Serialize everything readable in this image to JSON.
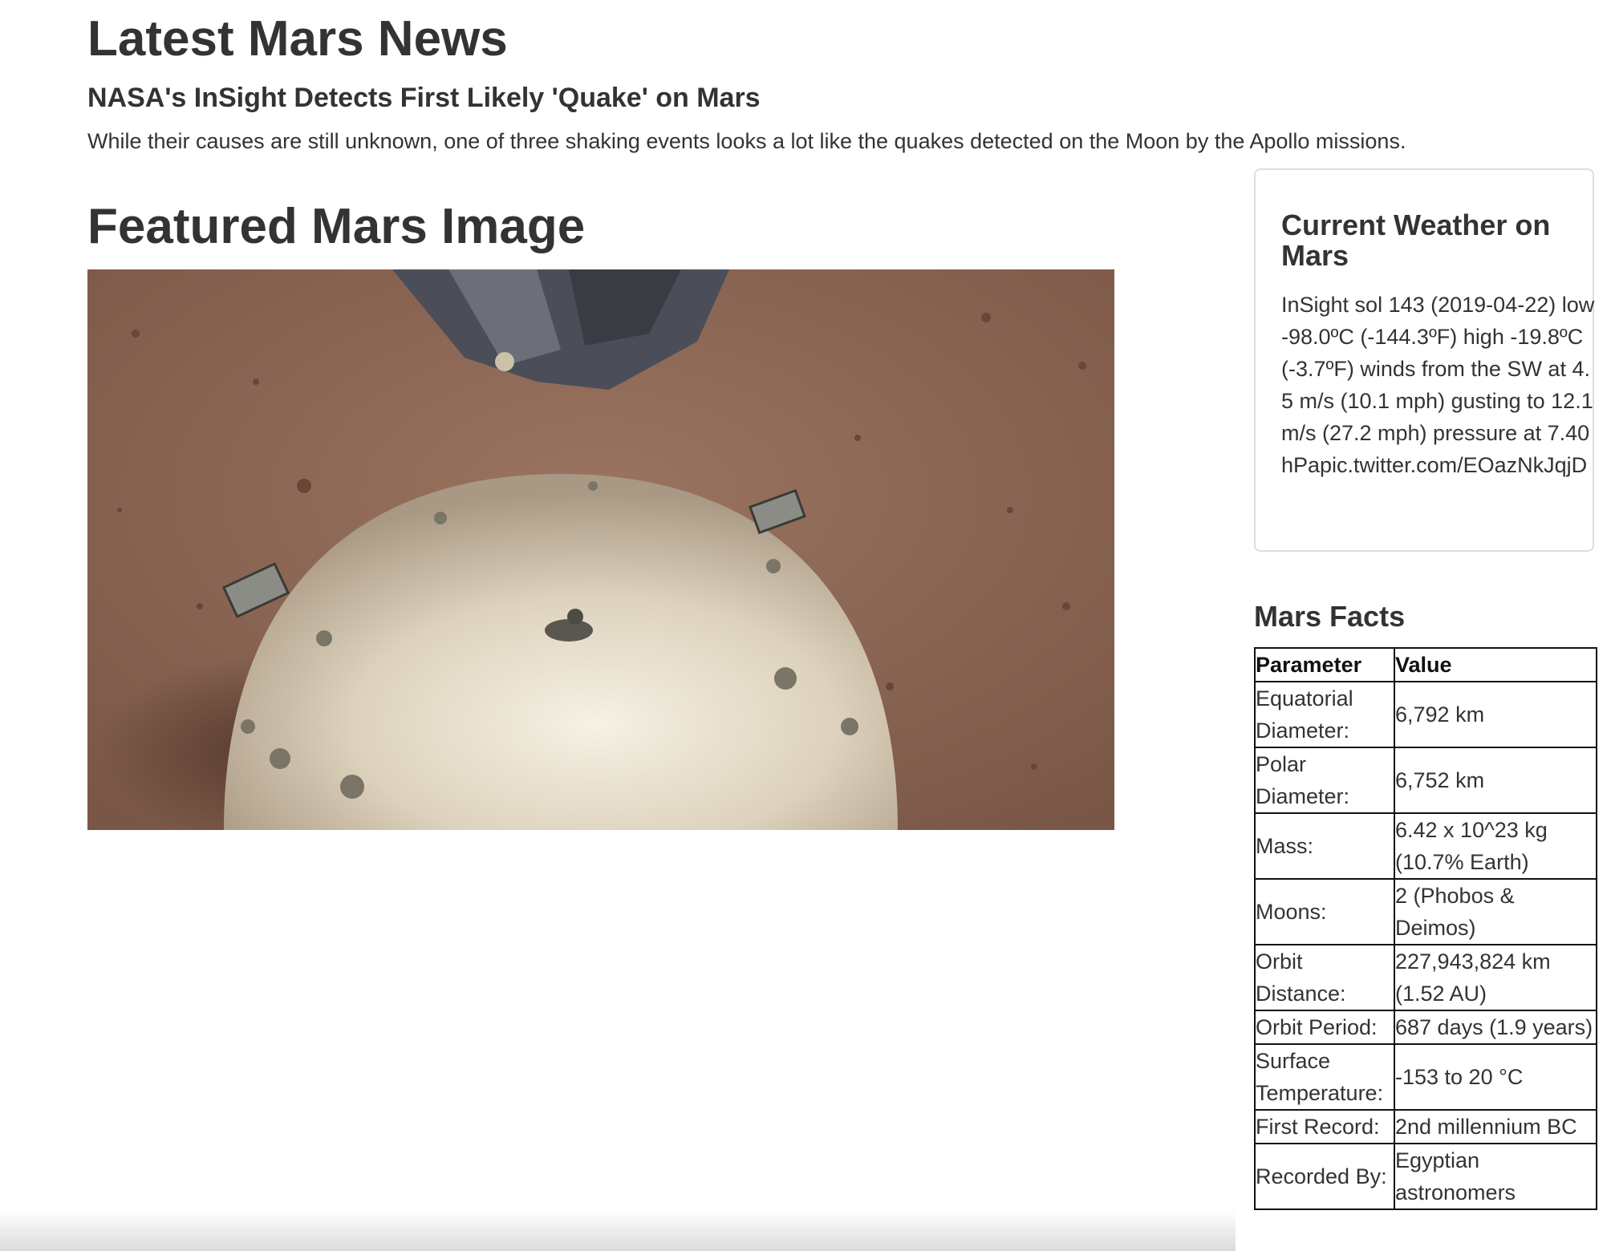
{
  "news": {
    "section_title": "Latest Mars News",
    "headline": "NASA's InSight Detects First Likely 'Quake' on Mars",
    "teaser": "While their causes are still unknown, one of three shaking events looks a lot like the quakes detected on the Moon by the Apollo missions."
  },
  "featured": {
    "section_title": "Featured Mars Image"
  },
  "weather": {
    "title": "Current Weather on Mars",
    "text": "InSight sol 143 (2019-04-22) low -98.0ºC (-144.3ºF) high -19.8ºC (-3.7ºF) winds from the SW at 4.5 m/s (10.1 mph) gusting to 12.1 m/s (27.2 mph) pressure at 7.40 hPapic.twitter.com/EOazNkJqjD"
  },
  "facts": {
    "title": "Mars Facts",
    "headers": [
      "Parameter",
      "Value"
    ],
    "rows": [
      [
        "Equatorial Diameter:",
        "6,792 km"
      ],
      [
        "Polar Diameter:",
        "6,752 km"
      ],
      [
        "Mass:",
        "6.42 x 10^23 kg (10.7% Earth)"
      ],
      [
        "Moons:",
        "2 (Phobos & Deimos)"
      ],
      [
        "Orbit Distance:",
        "227,943,824 km (1.52 AU)"
      ],
      [
        "Orbit Period:",
        "687 days (1.9 years)"
      ],
      [
        "Surface Temperature:",
        "-153 to 20 °C"
      ],
      [
        "First Record:",
        "2nd millennium BC"
      ],
      [
        "Recorded By:",
        "Egyptian astronomers"
      ]
    ]
  }
}
